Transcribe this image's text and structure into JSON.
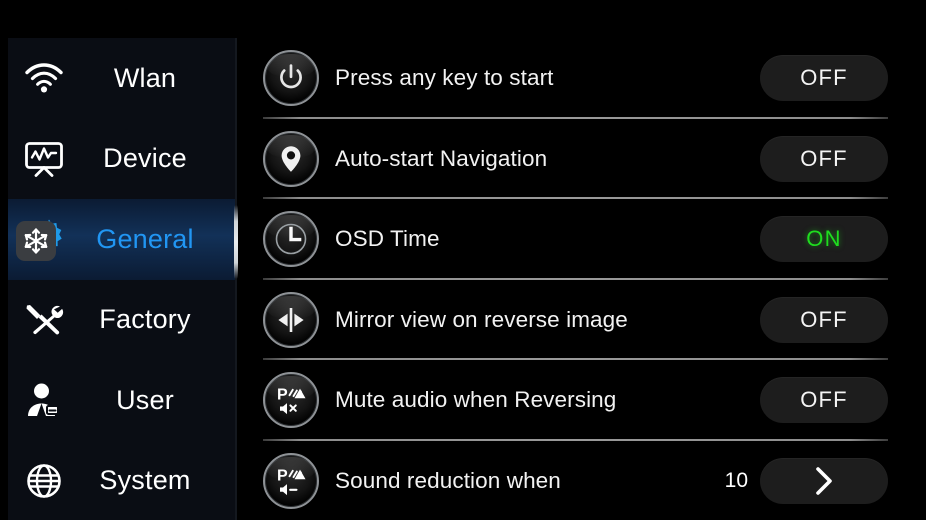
{
  "sidebar": {
    "items": [
      {
        "label": "Wlan",
        "icon": "wifi-icon",
        "active": false
      },
      {
        "label": "Device",
        "icon": "monitor-icon",
        "active": false
      },
      {
        "label": "General",
        "icon": "gear-icon",
        "active": true
      },
      {
        "label": "Factory",
        "icon": "tools-icon",
        "active": false
      },
      {
        "label": "User",
        "icon": "user-icon",
        "active": false
      },
      {
        "label": "System",
        "icon": "globe-icon",
        "active": false
      }
    ]
  },
  "main": {
    "rows": [
      {
        "label": "Press any key to start",
        "icon": "power-icon",
        "control": "toggle",
        "value": "OFF"
      },
      {
        "label": "Auto-start Navigation",
        "icon": "location-pin-icon",
        "control": "toggle",
        "value": "OFF"
      },
      {
        "label": "OSD Time",
        "icon": "clock-icon",
        "control": "toggle",
        "value": "ON"
      },
      {
        "label": "Mirror view on reverse image",
        "icon": "mirror-icon",
        "control": "toggle",
        "value": "OFF"
      },
      {
        "label": "Mute audio when Reversing",
        "icon": "parking-mute-icon",
        "control": "toggle",
        "value": "OFF"
      },
      {
        "label": "Sound reduction when",
        "icon": "parking-volume-icon",
        "control": "stepper",
        "value": "10",
        "chevron": "❯"
      }
    ]
  },
  "colors": {
    "accent_blue": "#2196f3",
    "on_green": "#1fdd1f",
    "pill_bg": "#1d1d1d",
    "sidebar_bg": "#0a0d14",
    "active_bg": "#123158"
  }
}
